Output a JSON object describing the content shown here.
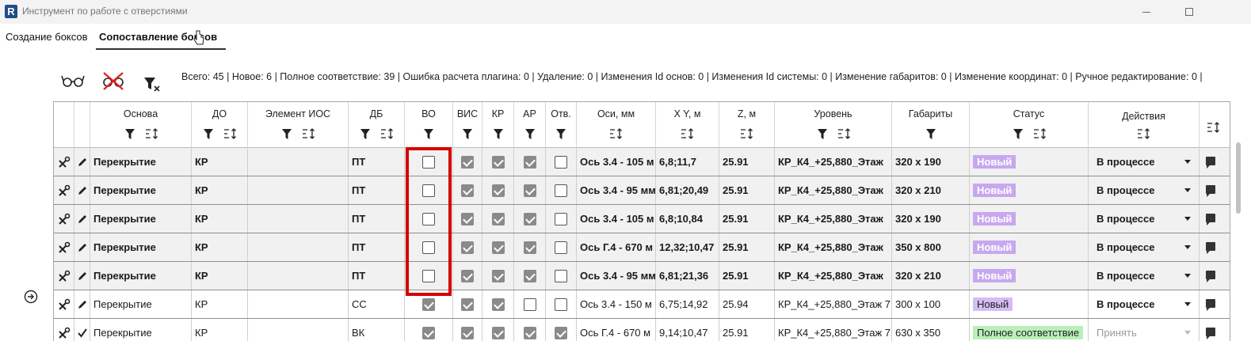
{
  "window": {
    "app_icon_letter": "R",
    "title": "Инструмент по работе с отверстиями"
  },
  "tabs": [
    {
      "label": "Создание боксов",
      "active": false
    },
    {
      "label": "Сопоставление боксов",
      "active": true
    }
  ],
  "toolbar": {
    "stats": "Всего: 45 | Новое: 6 | Полное соответствие: 39 | Ошибка расчета плагина: 0 | Удаление: 0 | Изменения Id основ: 0 | Изменения Id системы: 0 | Изменение габаритов: 0 | Изменение координат: 0 | Ручное редактирование: 0 |"
  },
  "grid": {
    "columns": [
      "Основа",
      "ДО",
      "Элемент ИОС",
      "ДБ",
      "ВО",
      "ВИС",
      "КР",
      "АР",
      "Отв.",
      "Оси, мм",
      "X Y, м",
      "Z, м",
      "Уровень",
      "Габариты",
      "Статус",
      "Действия"
    ],
    "rows": [
      {
        "osnova": "Перекрытие",
        "do": "КР",
        "ios": "",
        "db": "ПТ",
        "vo": false,
        "vis": true,
        "kr": true,
        "ar": true,
        "otv": false,
        "osi": "Ось 3.4 - 105 м",
        "xy": "6,8;11,7",
        "z": "25.91",
        "level": "КР_К4_+25,880_Этаж",
        "size": "320 x 190",
        "status": "Новый",
        "action": "В процессе"
      },
      {
        "osnova": "Перекрытие",
        "do": "КР",
        "ios": "",
        "db": "ПТ",
        "vo": false,
        "vis": true,
        "kr": true,
        "ar": true,
        "otv": false,
        "osi": "Ось 3.4 - 95 мм",
        "xy": "6,81;20,49",
        "z": "25.91",
        "level": "КР_К4_+25,880_Этаж",
        "size": "320 x 210",
        "status": "Новый",
        "action": "В процессе"
      },
      {
        "osnova": "Перекрытие",
        "do": "КР",
        "ios": "",
        "db": "ПТ",
        "vo": false,
        "vis": true,
        "kr": true,
        "ar": true,
        "otv": false,
        "osi": "Ось 3.4 - 105 м",
        "xy": "6,8;10,84",
        "z": "25.91",
        "level": "КР_К4_+25,880_Этаж",
        "size": "320 x 190",
        "status": "Новый",
        "action": "В процессе"
      },
      {
        "osnova": "Перекрытие",
        "do": "КР",
        "ios": "",
        "db": "ПТ",
        "vo": false,
        "vis": true,
        "kr": true,
        "ar": true,
        "otv": false,
        "osi": "Ось Г.4 - 670 м",
        "xy": "12,32;10,47",
        "z": "25.91",
        "level": "КР_К4_+25,880_Этаж",
        "size": "350 x 800",
        "status": "Новый",
        "action": "В процессе"
      },
      {
        "osnova": "Перекрытие",
        "do": "КР",
        "ios": "",
        "db": "ПТ",
        "vo": false,
        "vis": true,
        "kr": true,
        "ar": true,
        "otv": false,
        "osi": "Ось 3.4 - 95 мм",
        "xy": "6,81;21,36",
        "z": "25.91",
        "level": "КР_К4_+25,880_Этаж",
        "size": "320 x 210",
        "status": "Новый",
        "action": "В процессе"
      },
      {
        "osnova": "Перекрытие",
        "do": "КР",
        "ios": "",
        "db": "СС",
        "vo": true,
        "vis": true,
        "kr": true,
        "ar": false,
        "otv": false,
        "osi": "Ось 3.4 - 150 м",
        "xy": "6,75;14,92",
        "z": "25.94",
        "level": "КР_К4_+25,880_Этаж 7",
        "size": "300 x 100",
        "status": "Новый",
        "action": "В процессе"
      },
      {
        "osnova": "Перекрытие",
        "do": "КР",
        "ios": "",
        "db": "ВК",
        "vo": true,
        "vis": true,
        "kr": true,
        "ar": true,
        "otv": true,
        "osi": "Ось Г.4 - 670 м",
        "xy": "9,14;10,47",
        "z": "25.91",
        "level": "КР_К4_+25,880_Этаж 7",
        "size": "630 x 350",
        "status": "Полное соответствие",
        "action": "Принять"
      }
    ]
  },
  "colors": {
    "highlight": "#d40000",
    "status_new": "#c7a8ef",
    "status_ok": "#b8f0b8"
  }
}
